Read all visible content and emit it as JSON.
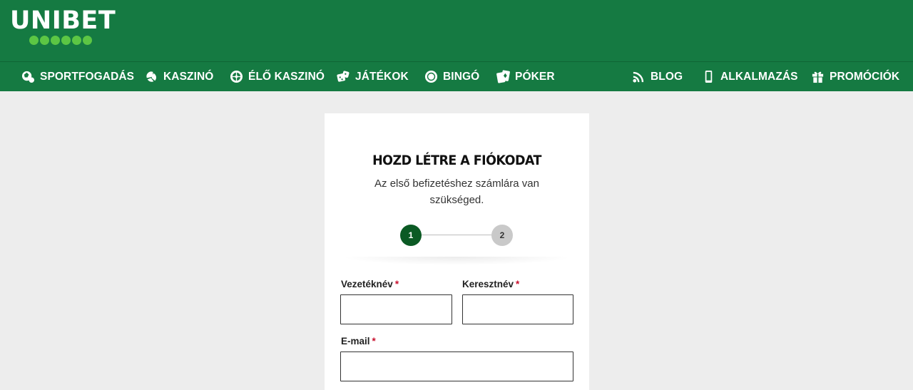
{
  "brand": {
    "name": "UNIBET"
  },
  "nav": {
    "left": [
      {
        "label": "SPORTFOGADÁS",
        "icon": "sports-ball-icon"
      },
      {
        "label": "KASZINÓ",
        "icon": "casino-chip-icon"
      },
      {
        "label": "ÉLŐ KASZINÓ",
        "icon": "roulette-icon"
      },
      {
        "label": "JÁTÉKOK",
        "icon": "dice-icon"
      },
      {
        "label": "BINGÓ",
        "icon": "bingo-ball-icon"
      },
      {
        "label": "PÓKER",
        "icon": "playing-cards-icon"
      }
    ],
    "right": [
      {
        "label": "BLOG",
        "icon": "rss-icon"
      },
      {
        "label": "ALKALMAZÁS",
        "icon": "mobile-phone-icon"
      },
      {
        "label": "PROMÓCIÓK",
        "icon": "gift-icon"
      }
    ]
  },
  "form": {
    "title": "HOZD LÉTRE A FIÓKODAT",
    "subtitle": "Az első befizetéshez számlára van szükséged.",
    "steps": [
      "1",
      "2"
    ],
    "current_step": 1,
    "fields": {
      "last_name": {
        "label": "Vezetéknév",
        "required_mark": "*",
        "value": ""
      },
      "first_name": {
        "label": "Keresztnév",
        "required_mark": "*",
        "value": ""
      },
      "email": {
        "label": "E-mail",
        "required_mark": "*",
        "value": ""
      }
    }
  },
  "colors": {
    "brand_green": "#157a42",
    "logo_dots": "#5cc644",
    "active_step": "#0b5a24",
    "inactive_step": "#c9c9c9",
    "required": "#c8102e",
    "background": "#ededed"
  }
}
